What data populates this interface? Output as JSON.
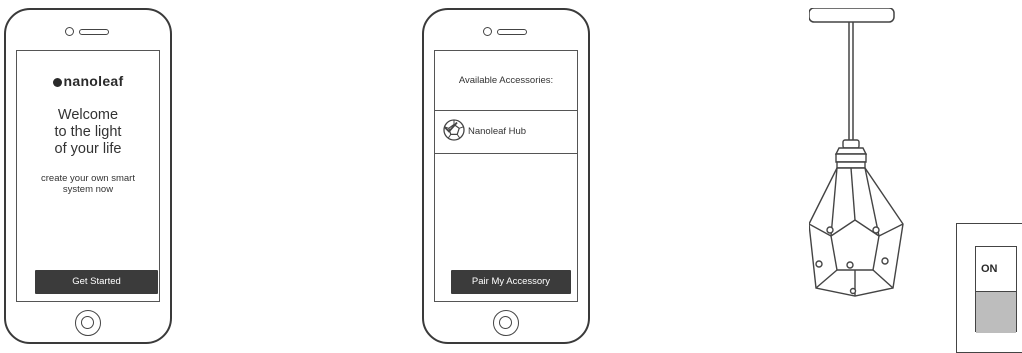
{
  "phone1": {
    "brand": "nanoleaf",
    "welcome_lines": [
      "Welcome",
      "to the light",
      "of your life"
    ],
    "tagline_lines": [
      "create your own smart",
      "system now"
    ],
    "button_label": "Get Started"
  },
  "phone2": {
    "header": "Available Accessories:",
    "accessory_name": "Nanoleaf Hub",
    "accessory_icon": "dodecahedron-icon",
    "accessory_selected": true,
    "button_label": "Pair My Accessory"
  },
  "switch": {
    "label": "ON"
  }
}
